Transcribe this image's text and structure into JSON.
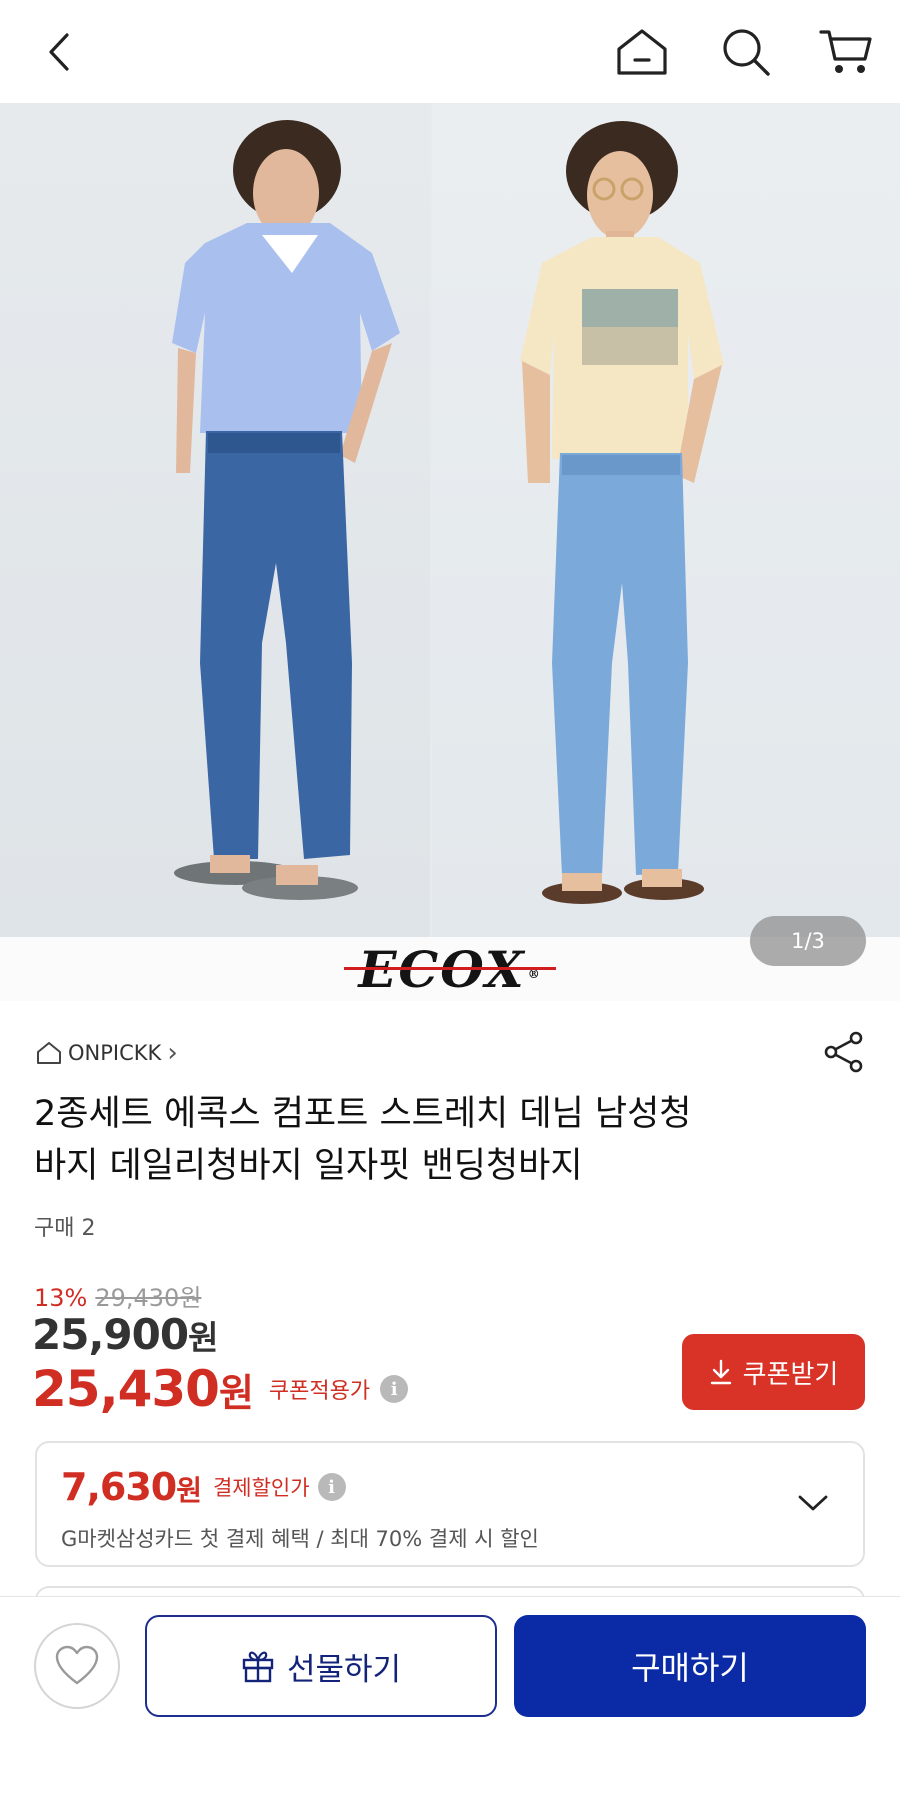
{
  "header": {
    "icons": [
      "back-arrow-icon",
      "home-icon",
      "search-icon",
      "cart-icon"
    ]
  },
  "gallery": {
    "brand_logo": "ECOX",
    "brand_logo_reg": "®",
    "pager": "1/3",
    "left_model": "blue shirt with dark denim pants",
    "right_model": "cream graphic tee with light denim pants"
  },
  "product": {
    "seller": "ONPICKK",
    "seller_chevron": "›",
    "title_line1": "2종세트 에콕스 컴포트 스트레치 데님 남성청",
    "title_line2": "바지 데일리청바지 일자핏 밴딩청바지",
    "purchase_count": "구매 2"
  },
  "pricing": {
    "discount_rate": "13%",
    "original_price": "29,430원",
    "price_value": "25,900",
    "price_unit": "원",
    "coupon_price_value": "25,430",
    "coupon_price_unit": "원",
    "coupon_price_label": "쿠폰적용가",
    "info_glyph": "i",
    "coupon_button": "쿠폰받기"
  },
  "card_offer": {
    "amount_value": "7,630",
    "amount_unit": "원",
    "label": "결제할인가",
    "info_glyph": "i",
    "description": "G마켓삼성카드 첫 결제 혜택 / 최대 70% 결제 시 할인"
  },
  "bottom_bar": {
    "gift_button": "선물하기",
    "buy_button": "구매하기"
  },
  "colors": {
    "accent_red": "#d12e23",
    "coupon_button": "#d93226",
    "buy_button": "#0a2aa6",
    "gift_border": "#1c2f8f"
  }
}
